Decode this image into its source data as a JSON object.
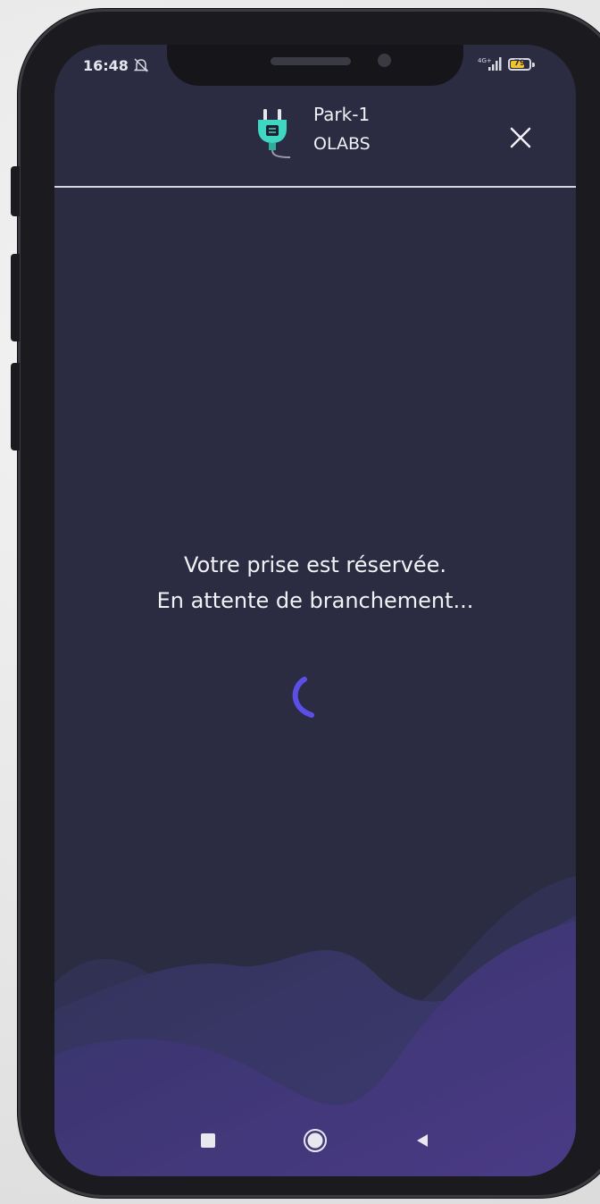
{
  "status_bar": {
    "time": "16:48",
    "network": "4G+",
    "battery_level": 79,
    "battery_label": "79",
    "icons": [
      "bell-off-icon",
      "signal-icon",
      "battery-icon"
    ]
  },
  "header": {
    "station_name": "Park-1",
    "operator": "OLABS",
    "icon": "plug-icon",
    "close_icon": "close-icon"
  },
  "message": {
    "line1": "Votre prise est réservée.",
    "line2": "En attente de branchement..."
  },
  "loading": {
    "icon": "spinner-icon"
  },
  "nav_bar": {
    "items": [
      "recents-button",
      "home-button",
      "back-button"
    ]
  },
  "colors": {
    "background": "#2b2b42",
    "spinner": "#5b4fe8",
    "plug": "#3fd6c2",
    "wave_dark": "#34345a",
    "wave_light": "#3e3775",
    "text": "#f2f2f6"
  }
}
